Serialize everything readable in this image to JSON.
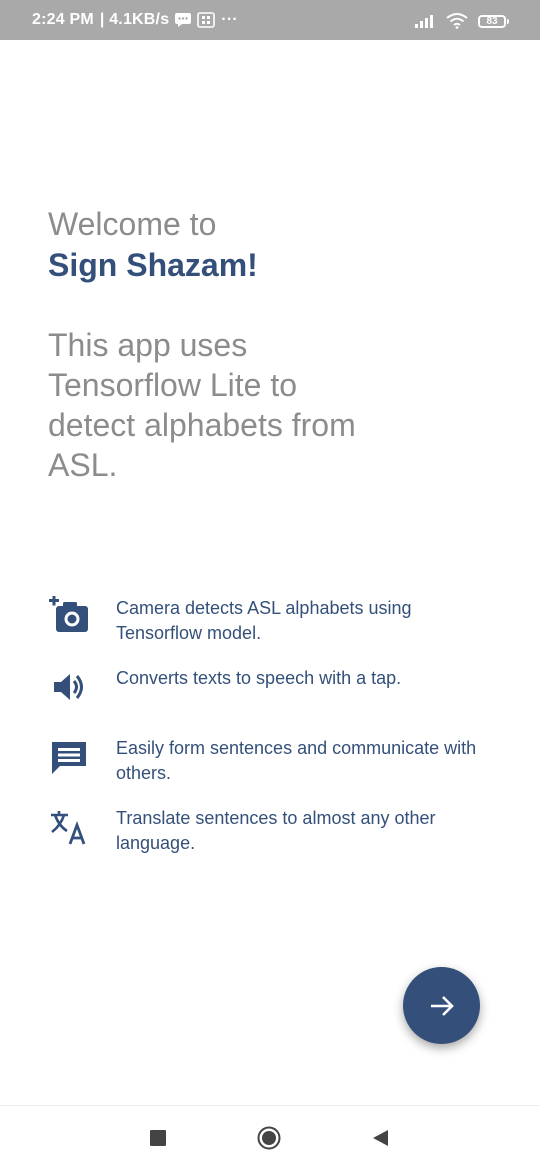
{
  "status_bar": {
    "time": "2:24 PM",
    "net_speed": "| 4.1KB/s",
    "battery_level": "83",
    "icons": [
      "message-icon",
      "sim-icon",
      "more-dots-icon",
      "signal-icon",
      "wifi-icon",
      "battery-icon"
    ]
  },
  "welcome": {
    "line1": "Welcome to",
    "app_name": "Sign Shazam!",
    "intro": "This app uses Tensorflow Lite to detect alphabets from ASL."
  },
  "features": [
    {
      "icon": "add-a-photo-icon",
      "text": "Camera detects ASL alphabets using Tensorflow model."
    },
    {
      "icon": "volume-up-icon",
      "text": "Converts texts to speech with a tap."
    },
    {
      "icon": "message-icon",
      "text": "Easily form sentences and communicate with others."
    },
    {
      "icon": "translate-icon",
      "text": "Translate sentences to almost any other language."
    }
  ],
  "fab": {
    "icon": "arrow-forward-icon"
  },
  "nav_bar": {
    "icons": [
      "recent-apps-icon",
      "home-icon",
      "back-icon"
    ]
  },
  "colors": {
    "primary": "#34507a",
    "body_text_grey": "#8c8c8c",
    "status_bar_bg": "#a9a9a9"
  }
}
